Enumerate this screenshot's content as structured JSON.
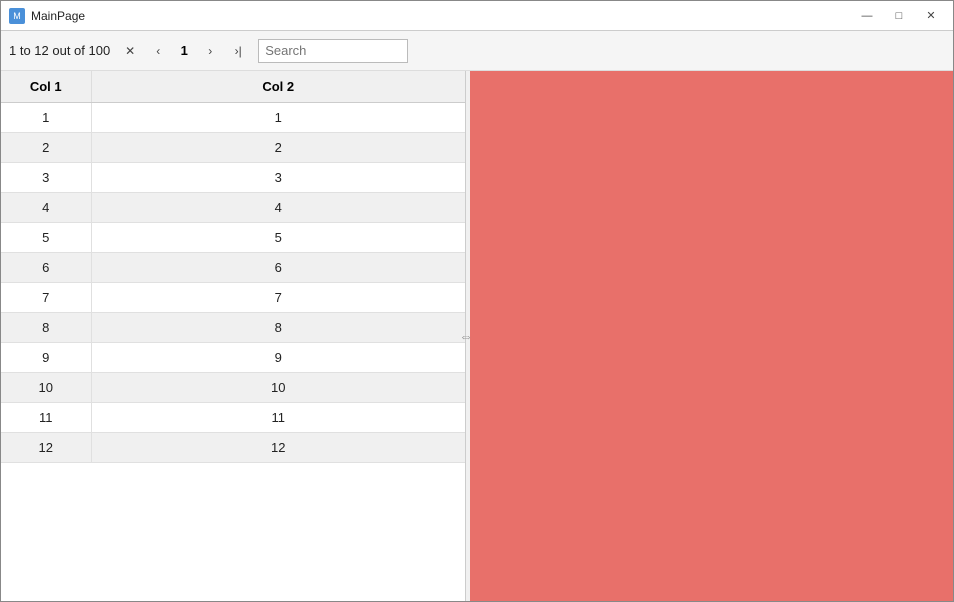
{
  "window": {
    "title": "MainPage"
  },
  "titlebar": {
    "minimize_label": "—",
    "maximize_label": "□",
    "close_label": "✕"
  },
  "toolbar": {
    "pagination_info": "1 to 12 out of 100",
    "close_filter_label": "✕",
    "prev_label": "‹",
    "page_number": "1",
    "next_label": "›",
    "last_label": "›|",
    "search_placeholder": "Search"
  },
  "table": {
    "columns": [
      "Col 1",
      "Col 2"
    ],
    "rows": [
      {
        "col1": 1,
        "col2": 1
      },
      {
        "col1": 2,
        "col2": 2
      },
      {
        "col1": 3,
        "col2": 3
      },
      {
        "col1": 4,
        "col2": 4
      },
      {
        "col1": 5,
        "col2": 5
      },
      {
        "col1": 6,
        "col2": 6
      },
      {
        "col1": 7,
        "col2": 7
      },
      {
        "col1": 8,
        "col2": 8
      },
      {
        "col1": 9,
        "col2": 9
      },
      {
        "col1": 10,
        "col2": 10
      },
      {
        "col1": 11,
        "col2": 11
      },
      {
        "col1": 12,
        "col2": 12
      }
    ]
  }
}
